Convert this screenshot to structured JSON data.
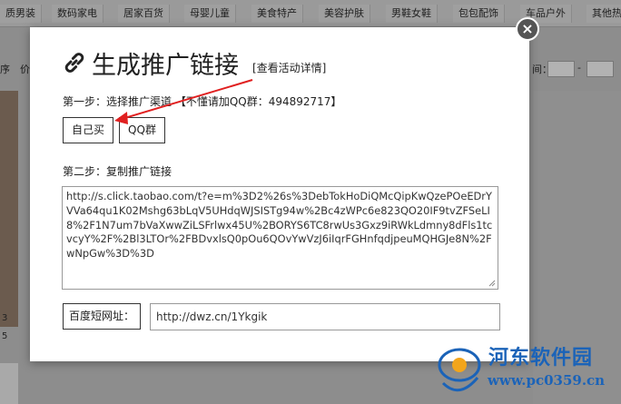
{
  "categories": [
    "质男装",
    "数码家电",
    "居家百货",
    "母婴儿童",
    "美食特产",
    "美容护肤",
    "男鞋女鞋",
    "包包配饰",
    "车品户外",
    "其他热"
  ],
  "filter": {
    "left_fragment_1": "序",
    "left_fragment_2": "价",
    "price_label": "间：",
    "dash": "-"
  },
  "left_text_1": "3",
  "left_text_2": "5",
  "modal": {
    "title": "生成推广链接",
    "detail_link": "[查看活动详情]",
    "step1": "第一步：选择推广渠道 【不懂请加QQ群：494892717】",
    "btn_self": "自己买",
    "btn_qq": "QQ群",
    "step2": "第二步：复制推广链接",
    "promo_link": "http://s.click.taobao.com/t?e=m%3D2%26s%3DebTokHoDiQMcQipKwQzePOeEDrYVVa64qu1K02Mshg63bLqV5UHdqWJSISTg94w%2Bc4zWPc6e823QO20IF9tvZFSeLI8%2F1N7um7bVaXwwZiLSFrlwx45U%2BORYS6TC8rwUs3Gxz9iRWkLdmny8dFls1tcvcyY%2F%2Bl3LTOr%2FBDvxlsQ0pOu6QOvYwVzJ6iIqrFGHnfqdjpeuMQHGJe8N%2FwNpGw%3D%3D",
    "short_label": "百度短网址：",
    "short_url": "http://dwz.cn/1Ykgik",
    "close": "×"
  },
  "icons": {
    "link": "link-icon",
    "close": "close-icon"
  },
  "colors": {
    "arrow": "#e02020",
    "watermark": "#1b63b8"
  },
  "watermark": {
    "name": "河东软件园",
    "url": "www.pc0359.cn"
  }
}
